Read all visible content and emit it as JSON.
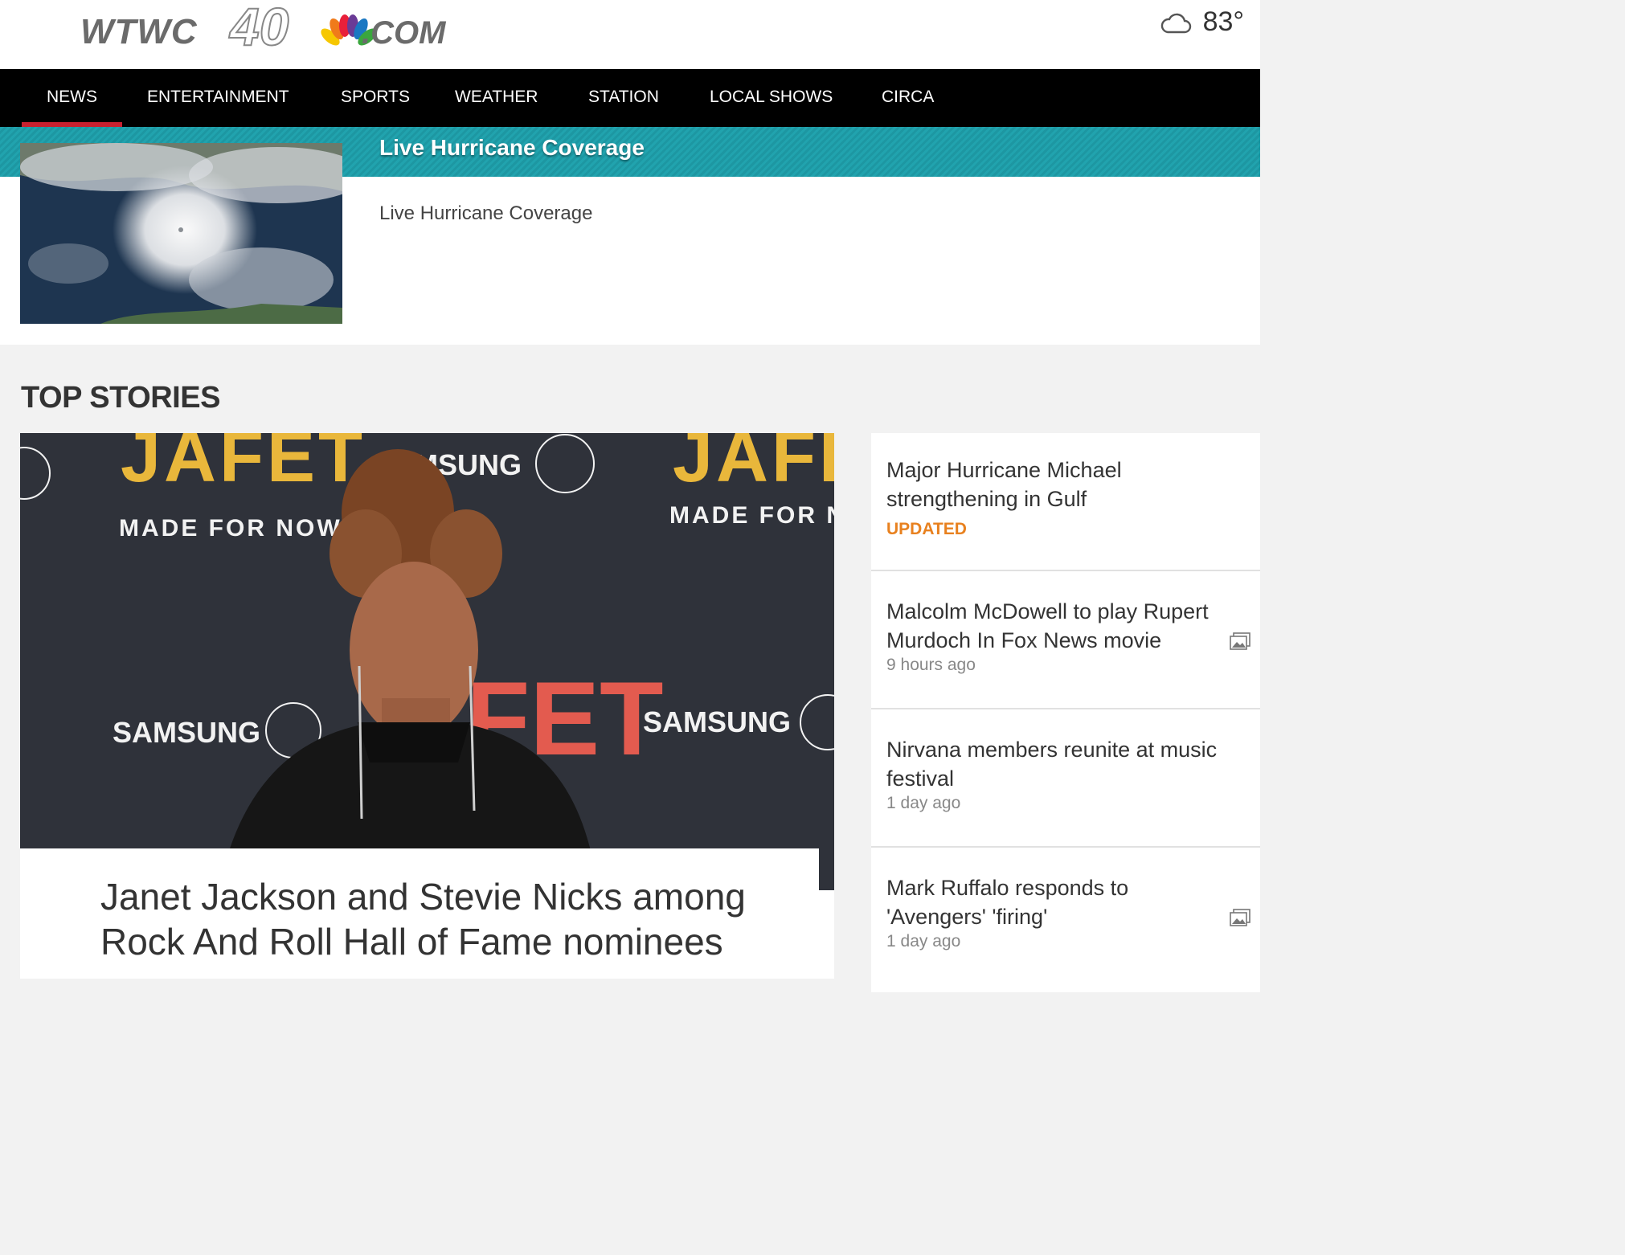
{
  "header": {
    "logo_text": "WTWC40 .COM",
    "weather": {
      "icon": "cloud-icon",
      "temperature": "83°"
    }
  },
  "nav": {
    "items": [
      {
        "label": "NEWS",
        "active": true
      },
      {
        "label": "ENTERTAINMENT"
      },
      {
        "label": "SPORTS"
      },
      {
        "label": "WEATHER"
      },
      {
        "label": "STATION"
      },
      {
        "label": "LOCAL SHOWS"
      },
      {
        "label": "CIRCA"
      }
    ],
    "active_color": "#c8202f"
  },
  "promo": {
    "banner_title": "Live Hurricane Coverage",
    "description": "Live Hurricane Coverage",
    "banner_color": "#1d97a2"
  },
  "top_stories": {
    "heading": "TOP STORIES",
    "hero": {
      "headline": "Janet Jackson and Stevie Nicks among Rock And Roll Hall of Fame nominees"
    },
    "list": [
      {
        "title": "Major Hurricane Michael strengthening in Gulf",
        "meta": "UPDATED",
        "meta_color": "#e8811f"
      },
      {
        "title": "Malcolm McDowell to play Rupert Murdoch In Fox News movie",
        "meta": "9 hours ago",
        "icon": "photo-gallery-icon"
      },
      {
        "title": "Nirvana members reunite at music festival",
        "meta": "1 day ago"
      },
      {
        "title": "Mark Ruffalo responds to 'Avengers' 'firing'",
        "meta": "1 day ago",
        "icon": "photo-gallery-icon"
      }
    ]
  }
}
